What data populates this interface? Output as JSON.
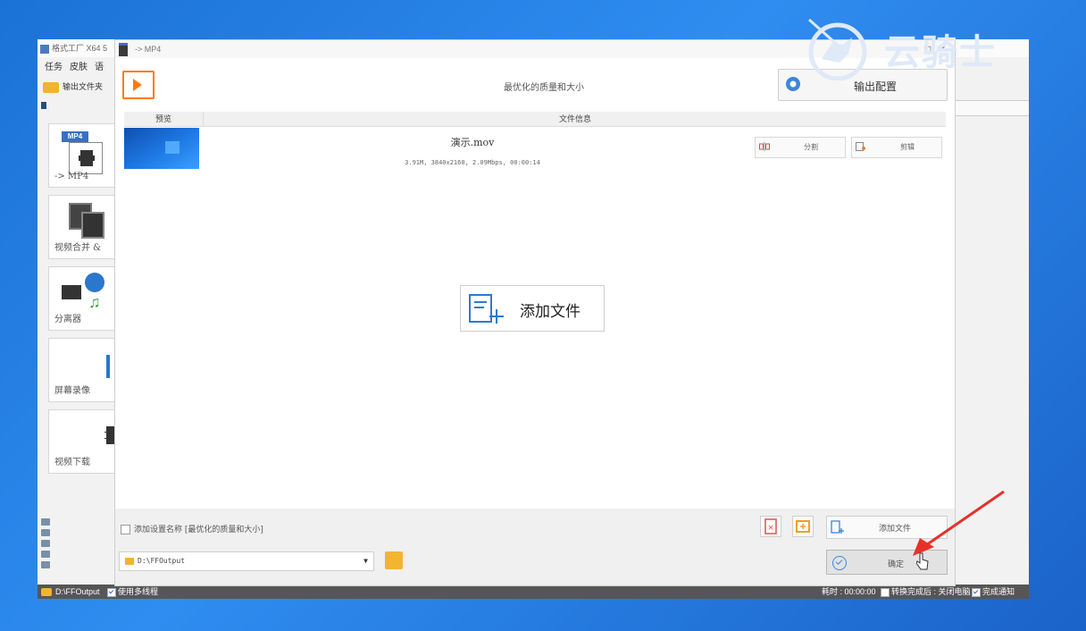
{
  "main_window": {
    "title": "格式工厂 X64 5",
    "menu": [
      "任务",
      "皮肤",
      "语"
    ],
    "output_folder_label": "输出文件夹",
    "tools": [
      {
        "label": "-> MP4",
        "badge": "MP4"
      },
      {
        "label": "视频合并 & "
      },
      {
        "label": "分离器"
      },
      {
        "label": "屏幕录像"
      },
      {
        "label": "视频下载"
      }
    ],
    "status": {
      "path": "D:\\FFOutput",
      "multithread_label": "使用多线程",
      "elapsed": "耗时 : 00:00:00",
      "after_convert": "转换完成后 : 关闭电脑",
      "notify": "完成通知"
    }
  },
  "dialog": {
    "title": "-> MP4",
    "quality_option": "最优化的质量和大小",
    "output_config_label": "输出配置",
    "columns": {
      "preview": "预览",
      "info": "文件信息"
    },
    "file": {
      "name": "演示.mov",
      "meta": "3.91M, 3840x2160, 2.09Mbps, 00:00:14",
      "split_label": "分割",
      "cut_label": "剪辑"
    },
    "add_file_big_label": "添加文件",
    "save_setting_name_label": "添加设置名称 [最优化的质量和大小]",
    "add_file_label": "添加文件",
    "output_path": "D:\\FFOutput",
    "ok_label": "确定"
  },
  "watermark": {
    "text": "云骑士"
  },
  "window_controls": {
    "maximize": "□",
    "close": "×"
  },
  "colors": {
    "accent": "#ff7a10",
    "folder": "#f0b52a",
    "desktop": "#2f8df0",
    "arrow": "#e8302a"
  }
}
